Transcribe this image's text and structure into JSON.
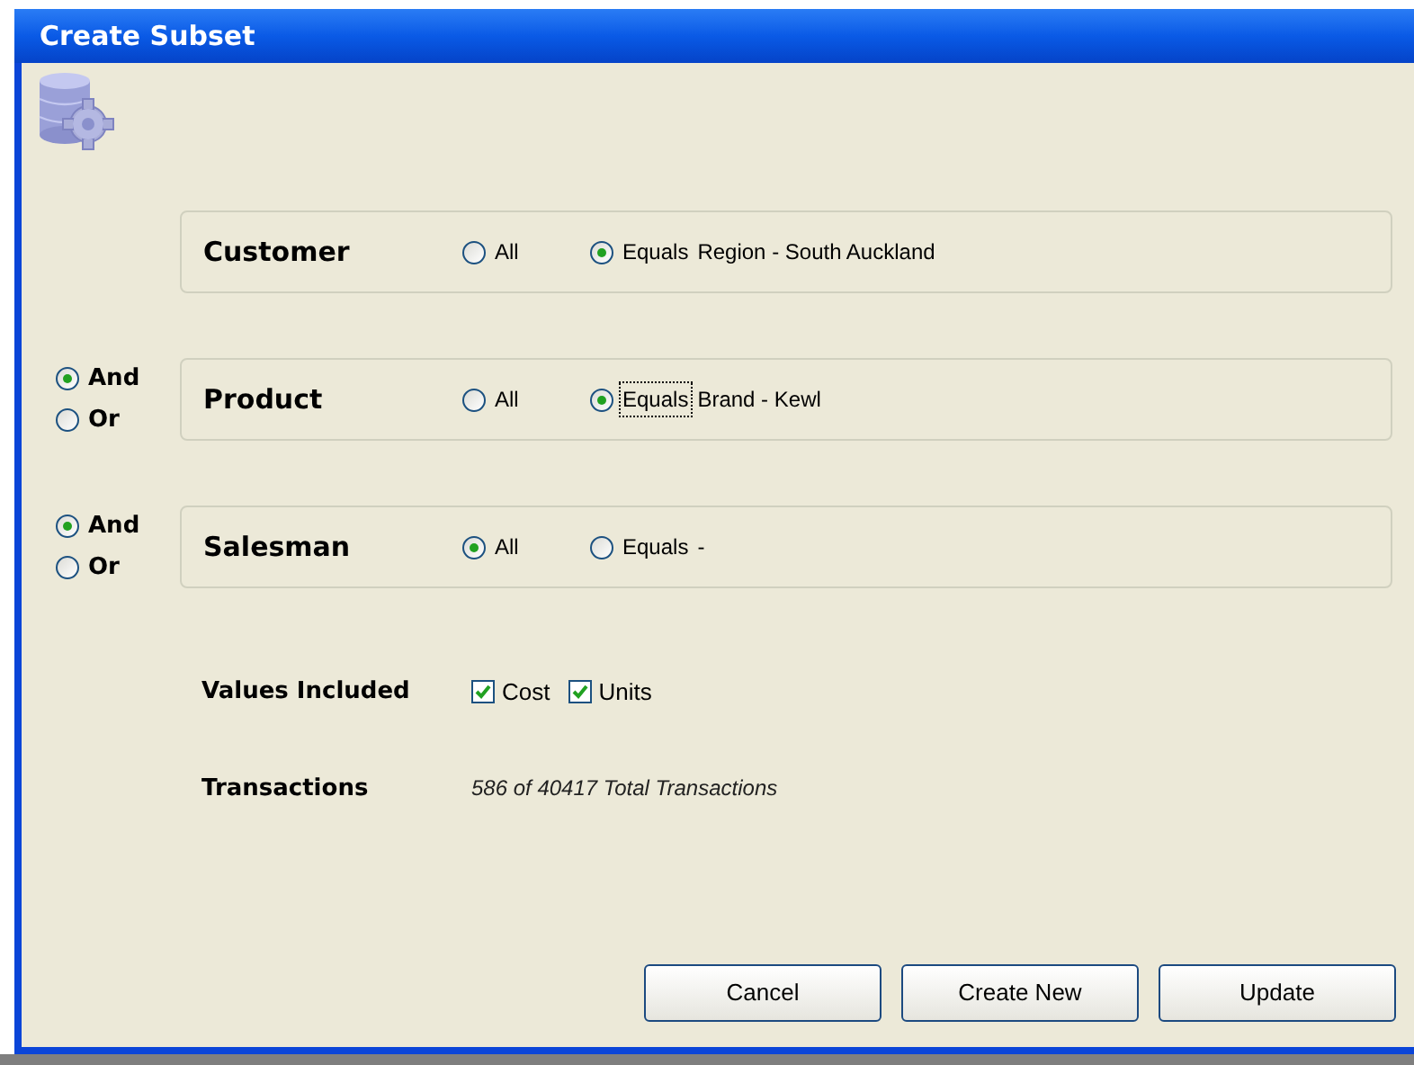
{
  "window": {
    "title": "Create Subset"
  },
  "filters": [
    {
      "label": "Customer",
      "options": [
        {
          "label": "All",
          "selected": false,
          "focused": false
        },
        {
          "label": "Equals",
          "selected": true,
          "focused": false,
          "value": "Region - South Auckland"
        }
      ]
    },
    {
      "label": "Product",
      "join": [
        {
          "label": "And",
          "selected": true
        },
        {
          "label": "Or",
          "selected": false
        }
      ],
      "options": [
        {
          "label": "All",
          "selected": false,
          "focused": false
        },
        {
          "label": "Equals",
          "selected": true,
          "focused": true,
          "value": "Brand - Kewl"
        }
      ]
    },
    {
      "label": "Salesman",
      "join": [
        {
          "label": "And",
          "selected": true
        },
        {
          "label": "Or",
          "selected": false
        }
      ],
      "options": [
        {
          "label": "All",
          "selected": true,
          "focused": false
        },
        {
          "label": "Equals",
          "selected": false,
          "focused": false,
          "value": "-"
        }
      ]
    }
  ],
  "values_included": {
    "label": "Values Included",
    "items": [
      {
        "label": "Cost",
        "checked": true
      },
      {
        "label": "Units",
        "checked": true
      }
    ]
  },
  "transactions": {
    "label": "Transactions",
    "value": "586 of 40417 Total Transactions"
  },
  "buttons": [
    "Cancel",
    "Create New",
    "Update"
  ]
}
